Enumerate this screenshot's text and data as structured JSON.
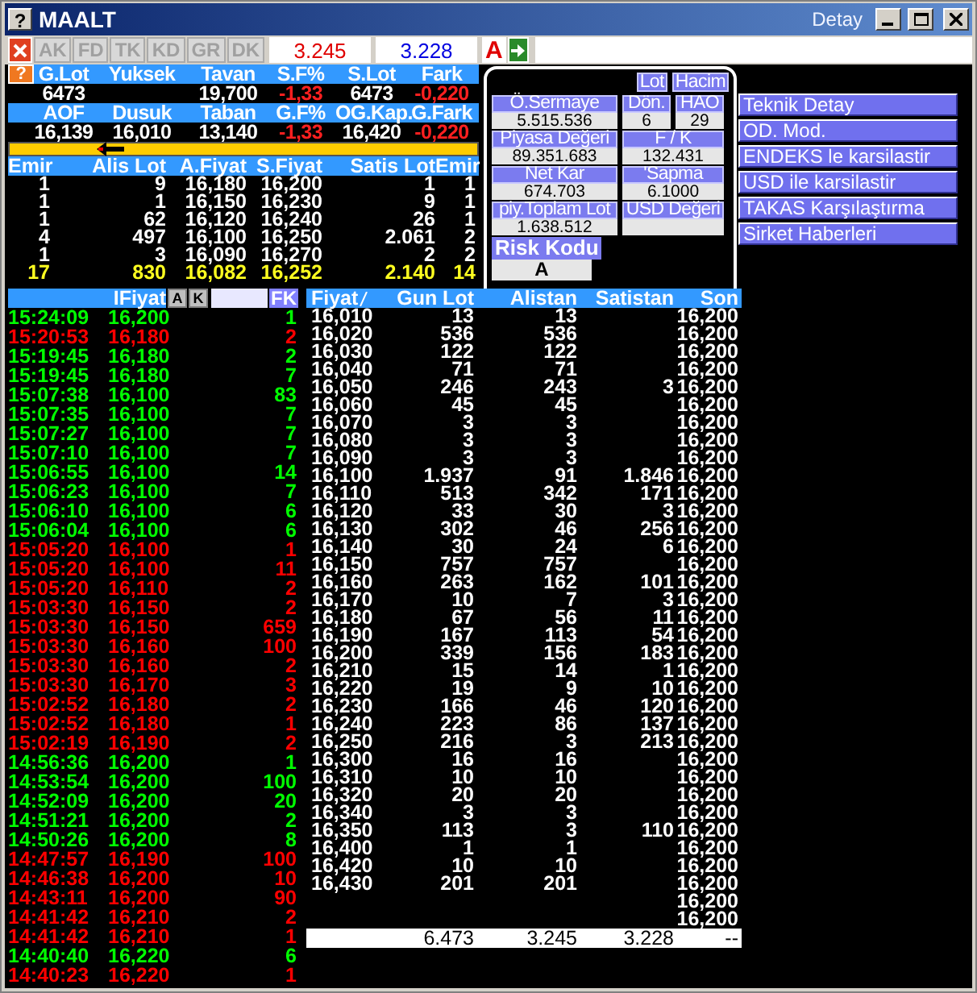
{
  "window": {
    "help": "?",
    "title": "MAALT",
    "menu": "Detay"
  },
  "toolbar": {
    "tabs": [
      {
        "label": "AK",
        "disabled": true
      },
      {
        "label": "FD",
        "disabled": true
      },
      {
        "label": "TK",
        "disabled": true
      },
      {
        "label": "KD",
        "disabled": true
      },
      {
        "label": "GR",
        "disabled": true
      },
      {
        "label": "DK",
        "disabled": true
      }
    ],
    "fields": [
      "3.245",
      "3.228"
    ],
    "mode": "A"
  },
  "stats": {
    "help": "?",
    "rows": [
      [
        {
          "label": "G.Lot",
          "value": "6473",
          "negative": false
        },
        {
          "label": "Yuksek"
        },
        {
          "label": "Tavan",
          "value": "19,700",
          "negative": false
        },
        {
          "label": "S.F%",
          "value": "-1,33",
          "negative": true
        },
        {
          "label": "S.Lot",
          "value": "6473",
          "negative": false
        },
        {
          "label": "Fark",
          "value": "-0,220",
          "negative": true
        }
      ],
      [
        {
          "label": "AOF",
          "value": "16,139",
          "negative": false
        },
        {
          "label": "Dusuk",
          "value": "16,010",
          "negative": false
        },
        {
          "label": "Taban",
          "value": "13,140",
          "negative": false
        },
        {
          "label": "G.F%",
          "value": "-1,33",
          "negative": true
        },
        {
          "label": "OG.Kap.",
          "value": "16,420",
          "negative": false
        },
        {
          "label": "G.Fark",
          "value": "-0,220",
          "negative": true
        }
      ]
    ]
  },
  "depth": {
    "columns": [
      "Emir",
      "Alis Lot",
      "A.Fiyat",
      "S.Fiyat",
      "Satis Lot",
      "Emir"
    ],
    "rows": [
      [
        "1",
        "9",
        "16,180",
        "16,200",
        "1",
        "1"
      ],
      [
        "1",
        "1",
        "16,150",
        "16,230",
        "9",
        "1"
      ],
      [
        "1",
        "62",
        "16,120",
        "16,240",
        "26",
        "1"
      ],
      [
        "4",
        "497",
        "16,100",
        "16,250",
        "2.061",
        "2"
      ],
      [
        "1",
        "3",
        "16,090",
        "16,270",
        "2",
        "2"
      ]
    ],
    "totals": [
      "17",
      "830",
      "16,082",
      "16,252",
      "2.140",
      "14"
    ]
  },
  "info_panel": {
    "buttons": [
      "Lot",
      "Hacim"
    ],
    "rows": [
      [
        {
          "label": "Ö.Sermaye",
          "value": "5.515.536"
        },
        {
          "label": "Dön.",
          "value": "6"
        },
        {
          "label": "HAO",
          "value": "29"
        }
      ],
      [
        {
          "label": "Piyasa Değeri",
          "value": "89.351.683"
        },
        {
          "label": "F / K",
          "value": "132.431"
        }
      ],
      [
        {
          "label": "Net Kar",
          "value": "674.703"
        },
        {
          "label": "'Sapma",
          "value": "6.1000"
        }
      ],
      [
        {
          "label": "piy.Toplam Lot",
          "value": "1.638.512"
        },
        {
          "label": "USD Değeri"
        }
      ]
    ],
    "risk": {
      "label": "Risk Kodu",
      "value": "A"
    }
  },
  "actions": [
    "Teknik Detay",
    "OD. Mod.",
    "ENDEKS le karsilastir",
    "USD ile karsilastir",
    "TAKAS Karşılaştırma",
    "Sirket Haberleri"
  ],
  "trades": {
    "header": "IFiyat",
    "buttons": [
      "A",
      "K"
    ],
    "filter_button": "FK",
    "rows": [
      {
        "time": "15:24:09",
        "price": "16,200",
        "lot": "1",
        "color": "#00ff00"
      },
      {
        "time": "15:20:53",
        "price": "16,180",
        "lot": "2",
        "color": "#ff0000"
      },
      {
        "time": "15:19:45",
        "price": "16,180",
        "lot": "2",
        "color": "#00ff00"
      },
      {
        "time": "15:19:45",
        "price": "16,180",
        "lot": "7",
        "color": "#00ff00"
      },
      {
        "time": "15:07:38",
        "price": "16,100",
        "lot": "83",
        "color": "#00ff00"
      },
      {
        "time": "15:07:35",
        "price": "16,100",
        "lot": "7",
        "color": "#00ff00"
      },
      {
        "time": "15:07:27",
        "price": "16,100",
        "lot": "7",
        "color": "#00ff00"
      },
      {
        "time": "15:07:10",
        "price": "16,100",
        "lot": "7",
        "color": "#00ff00"
      },
      {
        "time": "15:06:55",
        "price": "16,100",
        "lot": "14",
        "color": "#00ff00"
      },
      {
        "time": "15:06:23",
        "price": "16,100",
        "lot": "7",
        "color": "#00ff00"
      },
      {
        "time": "15:06:10",
        "price": "16,100",
        "lot": "6",
        "color": "#00ff00"
      },
      {
        "time": "15:06:04",
        "price": "16,100",
        "lot": "6",
        "color": "#00ff00"
      },
      {
        "time": "15:05:20",
        "price": "16,100",
        "lot": "1",
        "color": "#ff0000"
      },
      {
        "time": "15:05:20",
        "price": "16,100",
        "lot": "11",
        "color": "#ff0000"
      },
      {
        "time": "15:05:20",
        "price": "16,110",
        "lot": "2",
        "color": "#ff0000"
      },
      {
        "time": "15:03:30",
        "price": "16,150",
        "lot": "2",
        "color": "#ff0000"
      },
      {
        "time": "15:03:30",
        "price": "16,150",
        "lot": "659",
        "color": "#ff0000"
      },
      {
        "time": "15:03:30",
        "price": "16,160",
        "lot": "100",
        "color": "#ff0000"
      },
      {
        "time": "15:03:30",
        "price": "16,160",
        "lot": "2",
        "color": "#ff0000"
      },
      {
        "time": "15:03:30",
        "price": "16,170",
        "lot": "3",
        "color": "#ff0000"
      },
      {
        "time": "15:02:52",
        "price": "16,180",
        "lot": "2",
        "color": "#ff0000"
      },
      {
        "time": "15:02:52",
        "price": "16,180",
        "lot": "1",
        "color": "#ff0000"
      },
      {
        "time": "15:02:19",
        "price": "16,190",
        "lot": "2",
        "color": "#ff0000"
      },
      {
        "time": "14:56:36",
        "price": "16,200",
        "lot": "1",
        "color": "#00ff00"
      },
      {
        "time": "14:53:54",
        "price": "16,200",
        "lot": "100",
        "color": "#00ff00"
      },
      {
        "time": "14:52:09",
        "price": "16,200",
        "lot": "20",
        "color": "#00ff00"
      },
      {
        "time": "14:51:21",
        "price": "16,200",
        "lot": "2",
        "color": "#00ff00"
      },
      {
        "time": "14:50:26",
        "price": "16,200",
        "lot": "8",
        "color": "#00ff00"
      },
      {
        "time": "14:47:57",
        "price": "16,190",
        "lot": "100",
        "color": "#ff0000"
      },
      {
        "time": "14:46:38",
        "price": "16,200",
        "lot": "10",
        "color": "#ff0000"
      },
      {
        "time": "14:43:11",
        "price": "16,200",
        "lot": "90",
        "color": "#ff0000"
      },
      {
        "time": "14:41:42",
        "price": "16,210",
        "lot": "2",
        "color": "#ff0000"
      },
      {
        "time": "14:41:42",
        "price": "16,210",
        "lot": "1",
        "color": "#ff0000"
      },
      {
        "time": "14:40:40",
        "price": "16,220",
        "lot": "6",
        "color": "#00ff00"
      },
      {
        "time": "14:40:23",
        "price": "16,220",
        "lot": "1",
        "color": "#ff0000"
      }
    ]
  },
  "ladder": {
    "columns": [
      "Fiyat",
      "Gun Lot",
      "Alistan",
      "Satistan",
      "Son"
    ],
    "rows": [
      {
        "fiyat": "16,010",
        "gun_lot": "13",
        "alistan": "13",
        "son": "16,200"
      },
      {
        "fiyat": "16,020",
        "gun_lot": "536",
        "alistan": "536",
        "son": "16,200"
      },
      {
        "fiyat": "16,030",
        "gun_lot": "122",
        "alistan": "122",
        "son": "16,200"
      },
      {
        "fiyat": "16,040",
        "gun_lot": "71",
        "alistan": "71",
        "son": "16,200"
      },
      {
        "fiyat": "16,050",
        "gun_lot": "246",
        "alistan": "243",
        "satistan": "3",
        "son": "16,200"
      },
      {
        "fiyat": "16,060",
        "gun_lot": "45",
        "alistan": "45",
        "son": "16,200"
      },
      {
        "fiyat": "16,070",
        "gun_lot": "3",
        "alistan": "3",
        "son": "16,200"
      },
      {
        "fiyat": "16,080",
        "gun_lot": "3",
        "alistan": "3",
        "son": "16,200"
      },
      {
        "fiyat": "16,090",
        "gun_lot": "3",
        "alistan": "3",
        "son": "16,200"
      },
      {
        "fiyat": "16,100",
        "gun_lot": "1.937",
        "alistan": "91",
        "satistan": "1.846",
        "son": "16,200"
      },
      {
        "fiyat": "16,110",
        "gun_lot": "513",
        "alistan": "342",
        "satistan": "171",
        "son": "16,200"
      },
      {
        "fiyat": "16,120",
        "gun_lot": "33",
        "alistan": "30",
        "satistan": "3",
        "son": "16,200"
      },
      {
        "fiyat": "16,130",
        "gun_lot": "302",
        "alistan": "46",
        "satistan": "256",
        "son": "16,200"
      },
      {
        "fiyat": "16,140",
        "gun_lot": "30",
        "alistan": "24",
        "satistan": "6",
        "son": "16,200"
      },
      {
        "fiyat": "16,150",
        "gun_lot": "757",
        "alistan": "757",
        "son": "16,200"
      },
      {
        "fiyat": "16,160",
        "gun_lot": "263",
        "alistan": "162",
        "satistan": "101",
        "son": "16,200"
      },
      {
        "fiyat": "16,170",
        "gun_lot": "10",
        "alistan": "7",
        "satistan": "3",
        "son": "16,200"
      },
      {
        "fiyat": "16,180",
        "gun_lot": "67",
        "alistan": "56",
        "satistan": "11",
        "son": "16,200"
      },
      {
        "fiyat": "16,190",
        "gun_lot": "167",
        "alistan": "113",
        "satistan": "54",
        "son": "16,200"
      },
      {
        "fiyat": "16,200",
        "gun_lot": "339",
        "alistan": "156",
        "satistan": "183",
        "son": "16,200"
      },
      {
        "fiyat": "16,210",
        "gun_lot": "15",
        "alistan": "14",
        "satistan": "1",
        "son": "16,200"
      },
      {
        "fiyat": "16,220",
        "gun_lot": "19",
        "alistan": "9",
        "satistan": "10",
        "son": "16,200"
      },
      {
        "fiyat": "16,230",
        "gun_lot": "166",
        "alistan": "46",
        "satistan": "120",
        "son": "16,200"
      },
      {
        "fiyat": "16,240",
        "gun_lot": "223",
        "alistan": "86",
        "satistan": "137",
        "son": "16,200"
      },
      {
        "fiyat": "16,250",
        "gun_lot": "216",
        "alistan": "3",
        "satistan": "213",
        "son": "16,200"
      },
      {
        "fiyat": "16,300",
        "gun_lot": "16",
        "alistan": "16",
        "son": "16,200"
      },
      {
        "fiyat": "16,310",
        "gun_lot": "10",
        "alistan": "10",
        "son": "16,200"
      },
      {
        "fiyat": "16,320",
        "gun_lot": "20",
        "alistan": "20",
        "son": "16,200"
      },
      {
        "fiyat": "16,340",
        "gun_lot": "3",
        "alistan": "3",
        "son": "16,200"
      },
      {
        "fiyat": "16,350",
        "gun_lot": "113",
        "alistan": "3",
        "satistan": "110",
        "son": "16,200"
      },
      {
        "fiyat": "16,400",
        "gun_lot": "1",
        "alistan": "1",
        "son": "16,200"
      },
      {
        "fiyat": "16,420",
        "gun_lot": "10",
        "alistan": "10",
        "son": "16,200"
      },
      {
        "fiyat": "16,430",
        "gun_lot": "201",
        "alistan": "201",
        "son": "16,200"
      },
      {
        "son": "16,200"
      },
      {
        "son": "16,200"
      }
    ],
    "totals": {
      "gun_lot": "6.473",
      "alistan": "3.245",
      "satistan": "3.228",
      "son": "--"
    }
  }
}
